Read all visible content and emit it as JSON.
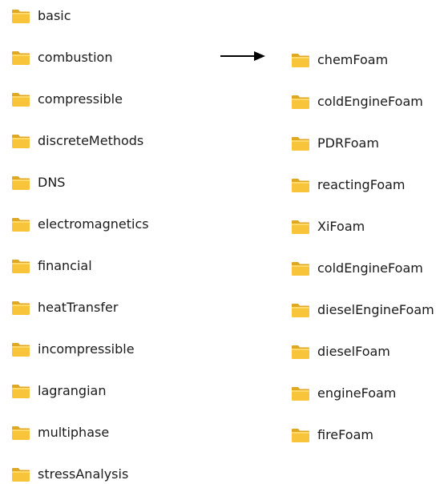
{
  "folders_left": [
    {
      "name": "basic"
    },
    {
      "name": "combustion"
    },
    {
      "name": "compressible"
    },
    {
      "name": "discreteMethods"
    },
    {
      "name": "DNS"
    },
    {
      "name": "electromagnetics"
    },
    {
      "name": "financial"
    },
    {
      "name": "heatTransfer"
    },
    {
      "name": "incompressible"
    },
    {
      "name": "lagrangian"
    },
    {
      "name": "multiphase"
    },
    {
      "name": "stressAnalysis"
    }
  ],
  "folders_right": [
    {
      "name": "chemFoam"
    },
    {
      "name": "coldEngineFoam"
    },
    {
      "name": "PDRFoam"
    },
    {
      "name": "reactingFoam"
    },
    {
      "name": "XiFoam"
    },
    {
      "name": "coldEngineFoam"
    },
    {
      "name": "dieselEngineFoam"
    },
    {
      "name": "dieselFoam"
    },
    {
      "name": "engineFoam"
    },
    {
      "name": "fireFoam"
    }
  ],
  "icons": {
    "folder": "folder-icon",
    "arrow": "right-arrow-icon"
  },
  "colors": {
    "folder_front": "#f8c53a",
    "folder_back": "#e0a722",
    "folder_highlight": "#ffd96a",
    "text": "#1a1a1a",
    "arrow": "#000000"
  }
}
